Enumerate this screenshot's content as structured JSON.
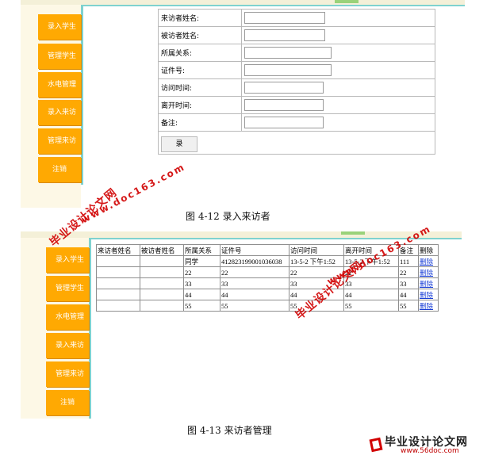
{
  "figure1": {
    "nav": [
      "录入学生",
      "管理学生",
      "水电管理",
      "录入来访",
      "管理来访",
      "注销"
    ],
    "form_fields": [
      "来访者姓名:",
      "被访者姓名:",
      "所属关系:",
      "证件号:",
      "访问时间:",
      "离开时间:",
      "备注:"
    ],
    "submit_label": "录",
    "caption": "图 4-12 录入来访者"
  },
  "figure2": {
    "nav": [
      "录入学生",
      "管理学生",
      "水电管理",
      "录入来访",
      "管理来访",
      "注销"
    ],
    "headers": [
      "来访者姓名",
      "被访者姓名",
      "所属关系",
      "证件号",
      "访问时间",
      "离开时间",
      "备注",
      "删除"
    ],
    "rows": [
      [
        "",
        "",
        "同学",
        "412823199001036038",
        "13-5-2 下午1:52",
        "13-5-2 下午1:52",
        "111",
        "删除"
      ],
      [
        "",
        "",
        "22",
        "22",
        "22",
        "22",
        "22",
        "删除"
      ],
      [
        "",
        "",
        "33",
        "33",
        "33",
        "33",
        "33",
        "删除"
      ],
      [
        "",
        "",
        "44",
        "44",
        "44",
        "44",
        "44",
        "删除"
      ],
      [
        "",
        "",
        "55",
        "55",
        "55",
        "55",
        "55",
        "删除"
      ]
    ],
    "caption": "图 4-13 来访者管理"
  },
  "watermark": {
    "brand": "毕业设计论文网",
    "url": "www.doc163.com",
    "footer_brand": "毕业设计论文网",
    "footer_url": "www.56doc.com"
  },
  "colors": {
    "nav_button": "#ffa902",
    "sidebar": "#fdf8e6",
    "separator": "#7fd2cf",
    "watermark": "#d10000",
    "link": "#1a3fd6"
  }
}
